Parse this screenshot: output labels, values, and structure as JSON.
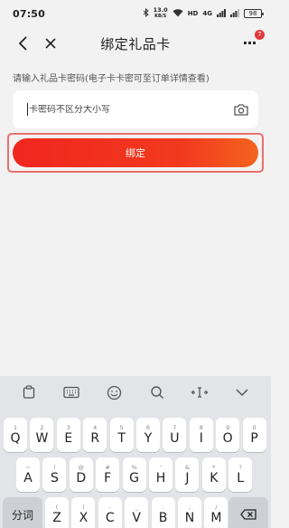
{
  "status_bar": {
    "time": "07:50",
    "net_speed_value": "13.0",
    "net_speed_unit": "KB/S",
    "hd_label": "HD",
    "signal_label": "4G",
    "battery": "98"
  },
  "header": {
    "title": "绑定礼品卡",
    "badge_count": "7"
  },
  "hint_text": "请输入礼品卡密码(电子卡卡密可至订单详情查看)",
  "card_input": {
    "placeholder": "卡密码不区分大小写",
    "value": ""
  },
  "bind_button_label": "绑定",
  "keyboard": {
    "row1": [
      {
        "main": "Q",
        "sub": "1"
      },
      {
        "main": "W",
        "sub": "2"
      },
      {
        "main": "E",
        "sub": "3"
      },
      {
        "main": "R",
        "sub": "4"
      },
      {
        "main": "T",
        "sub": "5"
      },
      {
        "main": "Y",
        "sub": "6"
      },
      {
        "main": "U",
        "sub": "7"
      },
      {
        "main": "I",
        "sub": "8"
      },
      {
        "main": "O",
        "sub": "9"
      },
      {
        "main": "P",
        "sub": "0"
      }
    ],
    "row2": [
      {
        "main": "A",
        "sub": "~"
      },
      {
        "main": "S",
        "sub": "!"
      },
      {
        "main": "D",
        "sub": "@"
      },
      {
        "main": "F",
        "sub": "#"
      },
      {
        "main": "G",
        "sub": "%"
      },
      {
        "main": "H",
        "sub": "'"
      },
      {
        "main": "J",
        "sub": "&"
      },
      {
        "main": "K",
        "sub": "*"
      },
      {
        "main": "L",
        "sub": "?"
      }
    ],
    "row3": [
      {
        "main": "Z",
        "sub": "("
      },
      {
        "main": "X",
        "sub": ")"
      },
      {
        "main": "C",
        "sub": "-"
      },
      {
        "main": "V",
        "sub": "_"
      },
      {
        "main": "B",
        "sub": ":"
      },
      {
        "main": "N",
        "sub": ";"
      },
      {
        "main": "M",
        "sub": "/"
      }
    ],
    "segment_key": "分词"
  },
  "colors": {
    "accent": "#f0261f",
    "badge": "#e4393c",
    "outline": "#e8706b"
  }
}
